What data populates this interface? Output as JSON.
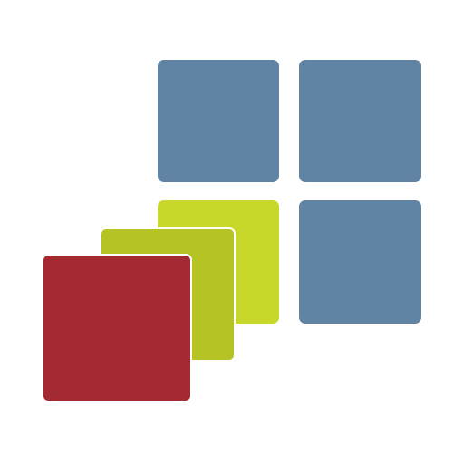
{
  "icon": {
    "name": "tiles-stack-logo",
    "colors": {
      "tile_blue": "#6183a4",
      "card_back": "#c8d82a",
      "card_middle": "#b5c424",
      "card_front": "#a32a31",
      "background": "#ffffff"
    }
  }
}
